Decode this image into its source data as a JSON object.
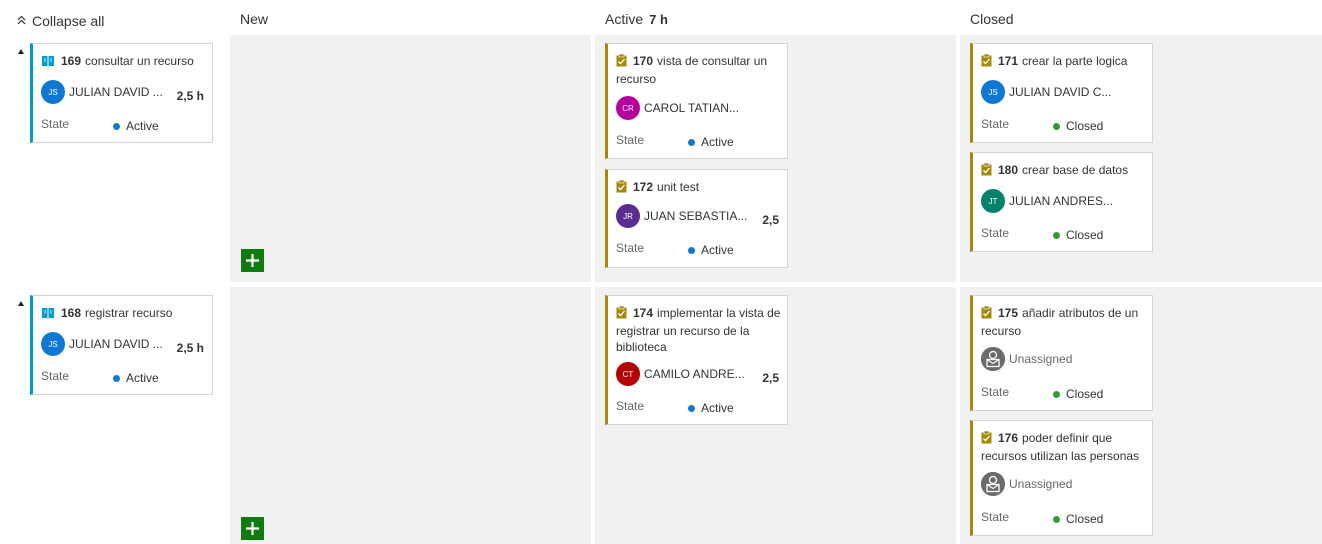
{
  "header": {
    "collapse_all_label": "Collapse all",
    "columns": [
      {
        "label": "New",
        "count": ""
      },
      {
        "label": "Active",
        "count": "7 h"
      },
      {
        "label": "Closed",
        "count": ""
      }
    ]
  },
  "rows": [
    {
      "parent": {
        "id": "169",
        "title": "consultar un recurso",
        "assignee": "JULIAN DAVID ...",
        "initials": "JS",
        "avatar_color": "#0f78d4",
        "effort": "2,5 h",
        "state_label": "State",
        "state": "Active",
        "state_color": "#0f78d4"
      },
      "active": [
        {
          "id": "170",
          "title": "vista de consultar un recurso",
          "assignee": "CAROL TATIAN...",
          "initials": "CR",
          "avatar_color": "#b4009e",
          "effort": "",
          "state_label": "State",
          "state": "Active",
          "state_color": "#0f78d4"
        },
        {
          "id": "172",
          "title": "unit test",
          "assignee": "JUAN SEBASTIA...",
          "initials": "JR",
          "avatar_color": "#5c2d91",
          "effort": "2,5",
          "state_label": "State",
          "state": "Active",
          "state_color": "#0f78d4"
        }
      ],
      "closed": [
        {
          "id": "171",
          "title": "crear la parte logica",
          "assignee": "JULIAN DAVID C...",
          "initials": "JS",
          "avatar_color": "#0f78d4",
          "effort": "",
          "state_label": "State",
          "state": "Closed",
          "state_color": "#339933"
        },
        {
          "id": "180",
          "title": "crear base de datos",
          "assignee": "JULIAN ANDRES...",
          "initials": "JT",
          "avatar_color": "#00826b",
          "effort": "",
          "state_label": "State",
          "state": "Closed",
          "state_color": "#339933"
        }
      ]
    },
    {
      "parent": {
        "id": "168",
        "title": "registrar recurso",
        "assignee": "JULIAN DAVID ...",
        "initials": "JS",
        "avatar_color": "#0f78d4",
        "effort": "2,5 h",
        "state_label": "State",
        "state": "Active",
        "state_color": "#0f78d4"
      },
      "active": [
        {
          "id": "174",
          "title": "implementar la vista de registrar un recurso de la biblioteca",
          "assignee": "CAMILO ANDRE...",
          "initials": "CT",
          "avatar_color": "#b30000",
          "effort": "2,5",
          "state_label": "State",
          "state": "Active",
          "state_color": "#0f78d4"
        }
      ],
      "closed": [
        {
          "id": "175",
          "title": "añadir atributos de un recurso",
          "assignee": "Unassigned",
          "initials": "",
          "avatar_color": "#6b6b6b",
          "effort": "",
          "state_label": "State",
          "state": "Closed",
          "state_color": "#339933"
        },
        {
          "id": "176",
          "title": "poder definir que recursos utilizan las personas",
          "assignee": "Unassigned",
          "initials": "",
          "avatar_color": "#6b6b6b",
          "effort": "",
          "state_label": "State",
          "state": "Closed",
          "state_color": "#339933"
        }
      ]
    }
  ],
  "icons": {
    "story": "book-icon",
    "task": "clipboard-icon",
    "unassigned": "unassigned-avatar-icon",
    "add": "plus-icon",
    "collapse": "double-chevron-up-icon",
    "expander": "triangle-up-icon"
  }
}
